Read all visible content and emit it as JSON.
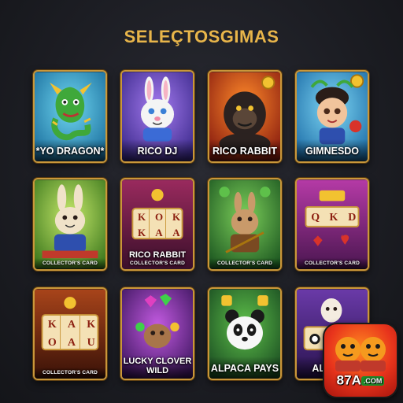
{
  "page": {
    "title": "SELEÇTOSGIMAS"
  },
  "games": [
    {
      "label": "*YO DRAGON*"
    },
    {
      "label": "RICO DJ"
    },
    {
      "label": "RICO RABBIT"
    },
    {
      "label": "GIMNESDO"
    },
    {
      "label": "COLLECTOR'S CARD"
    },
    {
      "label": "RICO RABBIT",
      "sublabel": "COLLECTOR'S CARD"
    },
    {
      "label": "COLLECTOR'S CARD"
    },
    {
      "label": "COLLECTOR'S CARD"
    },
    {
      "label": "COLLECTOR'S CARD"
    },
    {
      "label": "LUCKY CLOVER",
      "label2": "WILD"
    },
    {
      "label": "ALPACA PAYS"
    },
    {
      "label": "ALPACA"
    }
  ],
  "reel_symbols": {
    "card6": [
      "K",
      "O",
      "K",
      "K",
      "A",
      "A"
    ],
    "card8": [
      "Q",
      "K",
      "D"
    ],
    "card9": [
      "K",
      "A",
      "K",
      "O",
      "A",
      "U"
    ]
  },
  "badge": {
    "brand": "87A",
    "tld": ".COM"
  },
  "colors": {
    "accent_gold": "#e8b54a",
    "card_border": "#c9973a",
    "background": "#1c1d23"
  }
}
